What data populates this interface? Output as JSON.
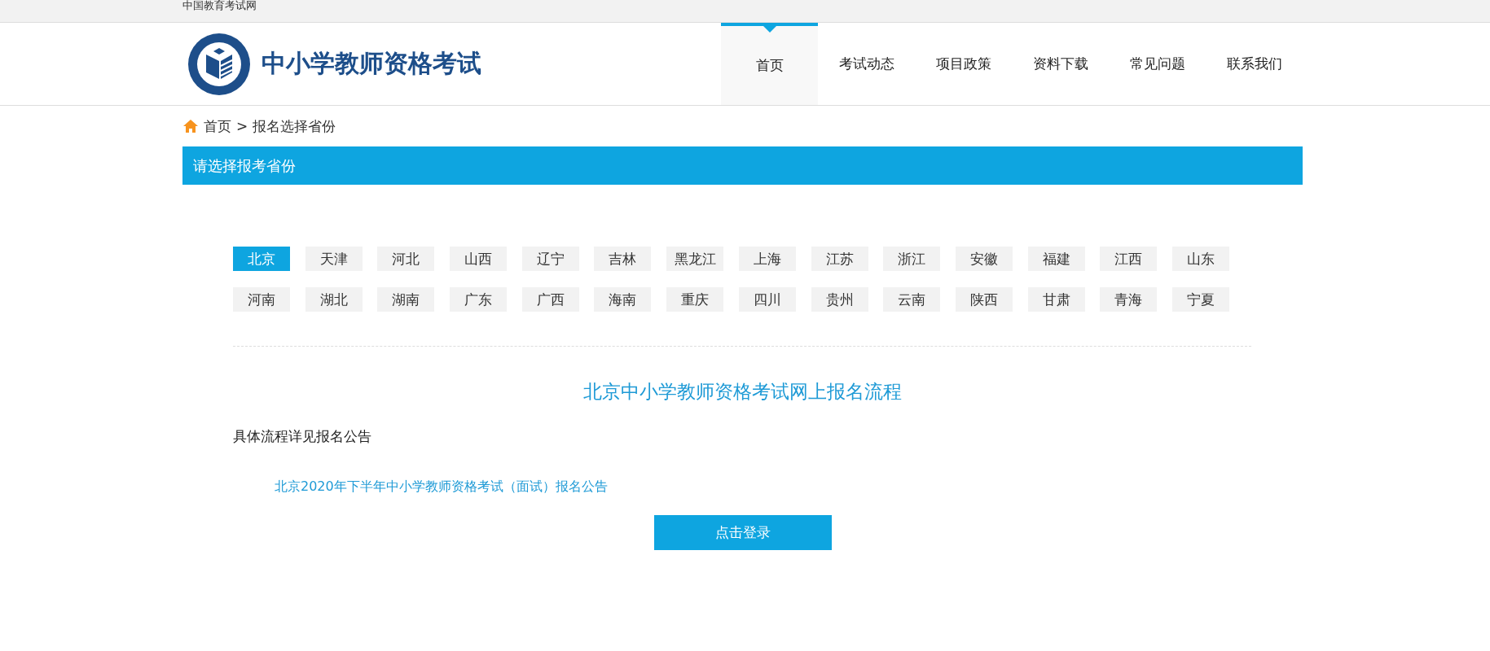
{
  "top_bar": {
    "site_name": "中国教育考试网"
  },
  "header": {
    "logo_title": "中小学教师资格考试",
    "nav": [
      {
        "label": "首页",
        "selected": true
      },
      {
        "label": "考试动态",
        "selected": false
      },
      {
        "label": "项目政策",
        "selected": false
      },
      {
        "label": "资料下载",
        "selected": false
      },
      {
        "label": "常见问题",
        "selected": false
      },
      {
        "label": "联系我们",
        "selected": false
      }
    ]
  },
  "breadcrumb": {
    "items": [
      "首页",
      "报名选择省份"
    ],
    "separator": ">"
  },
  "section_title": "请选择报考省份",
  "provinces": [
    {
      "label": "北京",
      "selected": true
    },
    {
      "label": "天津",
      "selected": false
    },
    {
      "label": "河北",
      "selected": false
    },
    {
      "label": "山西",
      "selected": false
    },
    {
      "label": "辽宁",
      "selected": false
    },
    {
      "label": "吉林",
      "selected": false
    },
    {
      "label": "黑龙江",
      "selected": false
    },
    {
      "label": "上海",
      "selected": false
    },
    {
      "label": "江苏",
      "selected": false
    },
    {
      "label": "浙江",
      "selected": false
    },
    {
      "label": "安徽",
      "selected": false
    },
    {
      "label": "福建",
      "selected": false
    },
    {
      "label": "江西",
      "selected": false
    },
    {
      "label": "山东",
      "selected": false
    },
    {
      "label": "河南",
      "selected": false
    },
    {
      "label": "湖北",
      "selected": false
    },
    {
      "label": "湖南",
      "selected": false
    },
    {
      "label": "广东",
      "selected": false
    },
    {
      "label": "广西",
      "selected": false
    },
    {
      "label": "海南",
      "selected": false
    },
    {
      "label": "重庆",
      "selected": false
    },
    {
      "label": "四川",
      "selected": false
    },
    {
      "label": "贵州",
      "selected": false
    },
    {
      "label": "云南",
      "selected": false
    },
    {
      "label": "陕西",
      "selected": false
    },
    {
      "label": "甘肃",
      "selected": false
    },
    {
      "label": "青海",
      "selected": false
    },
    {
      "label": "宁夏",
      "selected": false
    }
  ],
  "process": {
    "title": "北京中小学教师资格考试网上报名流程",
    "note": "具体流程详见报名公告",
    "links": [
      "北京2020年下半年中小学教师资格考试（面试）报名公告"
    ],
    "button": "点击登录"
  }
}
